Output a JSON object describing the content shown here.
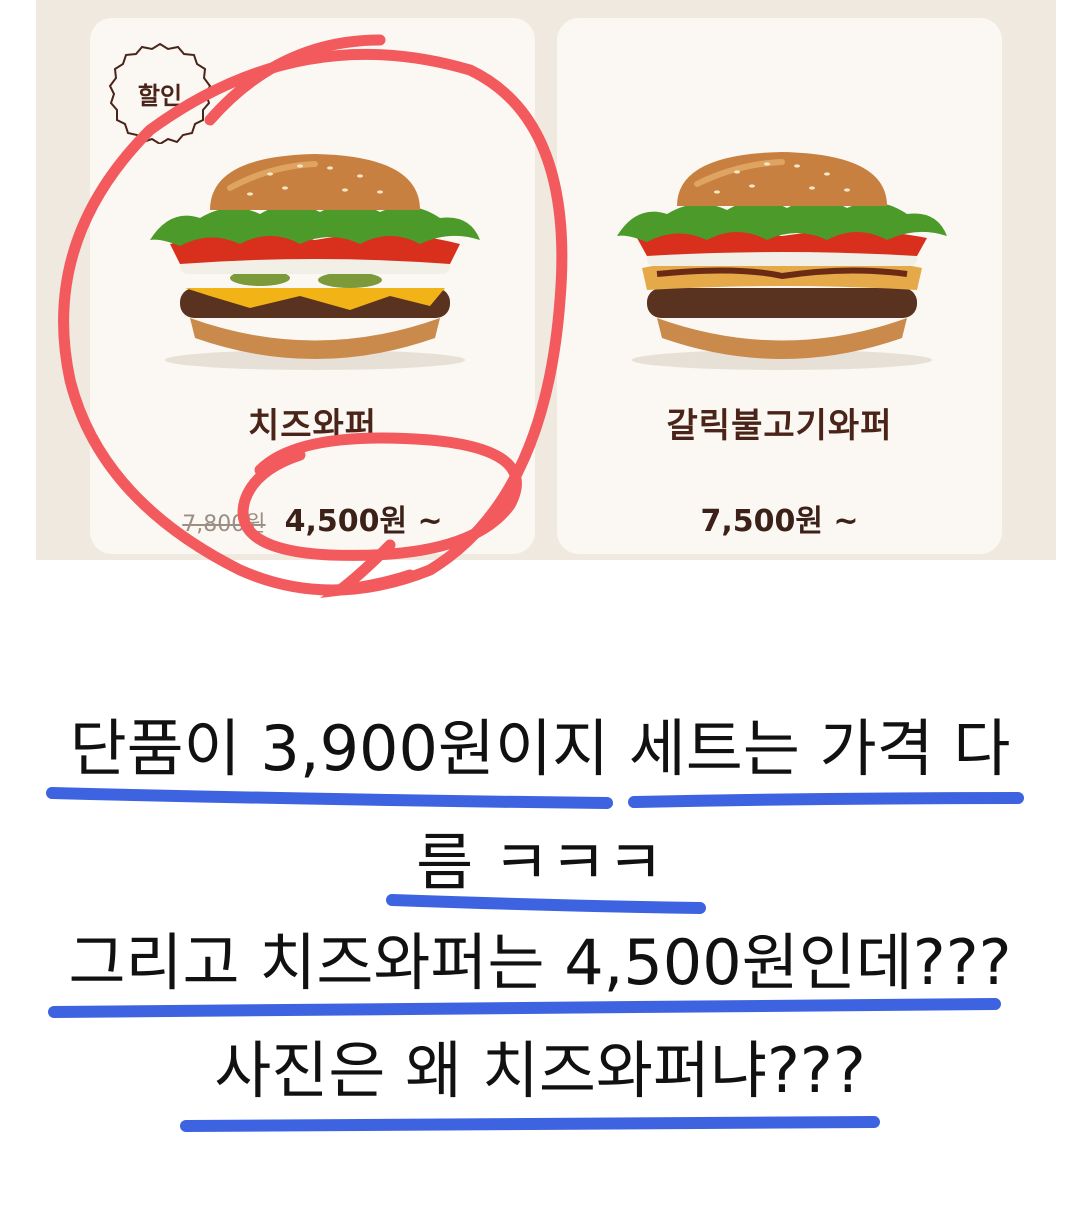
{
  "menu": {
    "items": [
      {
        "name": "치즈와퍼",
        "badge": "할인",
        "original_price": "7,800원",
        "price": "4,500원 ~"
      },
      {
        "name": "갈릭불고기와퍼",
        "price": "7,500원 ~"
      }
    ]
  },
  "annotation": {
    "circle_color": "#f25a5e",
    "underline_color": "#3d63e0"
  },
  "captions": [
    "단품이 3,900원이지 세트는 가격 다",
    "름 ㅋㅋㅋ",
    "그리고 치즈와퍼는 4,500원인데???",
    "사진은 왜 치즈와퍼냐???"
  ]
}
